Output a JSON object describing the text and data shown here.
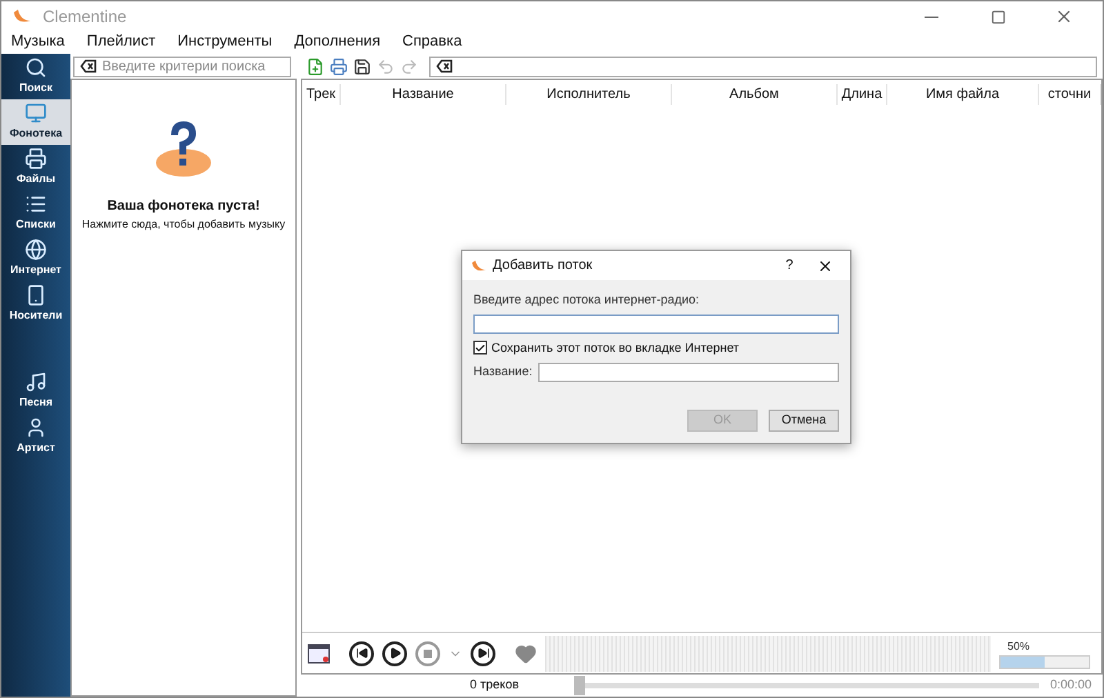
{
  "window": {
    "title": "Clementine"
  },
  "menu": [
    "Музыка",
    "Плейлист",
    "Инструменты",
    "Дополнения",
    "Справка"
  ],
  "sidebar": {
    "items": [
      {
        "label": "Поиск",
        "kind": "search",
        "selected": false
      },
      {
        "label": "Фонотека",
        "kind": "library",
        "selected": true
      },
      {
        "label": "Файлы",
        "kind": "files",
        "selected": false
      },
      {
        "label": "Списки",
        "kind": "lists",
        "selected": false
      },
      {
        "label": "Интернет",
        "kind": "internet",
        "selected": false
      },
      {
        "label": "Носители",
        "kind": "devices",
        "selected": false
      },
      {
        "label": "Песня",
        "kind": "song",
        "selected": false
      },
      {
        "label": "Артист",
        "kind": "artist",
        "selected": false
      }
    ]
  },
  "library": {
    "search_placeholder": "Введите критерии поиска",
    "empty_title": "Ваша фонотека пуста!",
    "empty_hint": "Нажмите сюда, чтобы добавить музыку"
  },
  "playlist": {
    "columns": [
      "Трек",
      "Название",
      "Исполнитель",
      "Альбом",
      "Длина",
      "Имя файла",
      "сточни"
    ]
  },
  "player": {
    "volume": {
      "reading": "50%",
      "level": 0.5
    },
    "status": "0 треков",
    "seek": {
      "level": 0
    },
    "time": "0:00:00"
  },
  "dialog": {
    "title": "Добавить поток",
    "help": "?",
    "url_label": "Введите адрес потока интернет-радио:",
    "save_checkbox": {
      "label": "Сохранить этот поток во вкладке Интернет",
      "checked": true
    },
    "name_label": "Название:",
    "buttons": [
      {
        "label": "OK",
        "disabled": true
      },
      {
        "label": "Отмена",
        "disabled": false
      }
    ]
  }
}
